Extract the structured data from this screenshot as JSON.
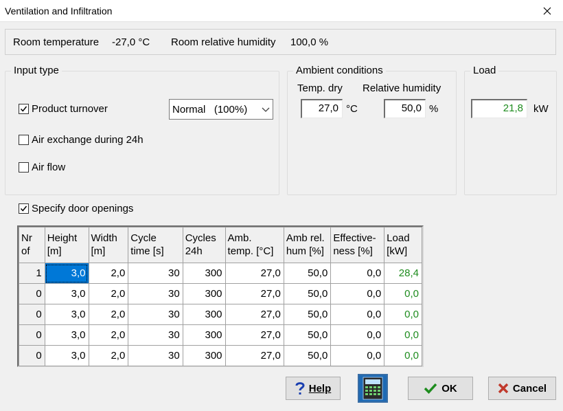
{
  "window": {
    "title": "Ventilation and Infiltration"
  },
  "status": {
    "room_temperature_label": "Room temperature",
    "room_temperature_value": "-27,0 °C",
    "room_humidity_label": "Room relative humidity",
    "room_humidity_value": "100,0 %"
  },
  "input_type": {
    "group_label": "Input type",
    "product_turnover": {
      "label": "Product turnover",
      "checked": true
    },
    "turnover_select": "Normal   (100%)",
    "air_exchange": {
      "label": "Air exchange during 24h",
      "checked": false
    },
    "air_flow": {
      "label": "Air flow",
      "checked": false
    }
  },
  "ambient": {
    "group_label": "Ambient conditions",
    "temp_dry_label": "Temp. dry",
    "rel_humidity_label": "Relative humidity",
    "temp_dry_value": "27,0",
    "temp_unit": "°C",
    "rel_humidity_value": "50,0",
    "humidity_unit": "%"
  },
  "load": {
    "group_label": "Load",
    "value": "21,8",
    "unit": "kW"
  },
  "door_openings": {
    "label": "Specify door openings",
    "checked": true,
    "columns": [
      [
        "Nr",
        "of"
      ],
      [
        "Height",
        "[m]"
      ],
      [
        "Width",
        "[m]"
      ],
      [
        "Cycle",
        "time [s]"
      ],
      [
        "Cycles",
        "24h"
      ],
      [
        "Amb.",
        "temp. [°C]"
      ],
      [
        "Amb rel.",
        "hum [%]"
      ],
      [
        "Effective-",
        "ness [%]"
      ],
      [
        "Load",
        "[kW]"
      ]
    ],
    "rows": [
      [
        "1",
        "3,0",
        "2,0",
        "30",
        "300",
        "27,0",
        "50,0",
        "0,0",
        "28,4"
      ],
      [
        "0",
        "3,0",
        "2,0",
        "30",
        "300",
        "27,0",
        "50,0",
        "0,0",
        "0,0"
      ],
      [
        "0",
        "3,0",
        "2,0",
        "30",
        "300",
        "27,0",
        "50,0",
        "0,0",
        "0,0"
      ],
      [
        "0",
        "3,0",
        "2,0",
        "30",
        "300",
        "27,0",
        "50,0",
        "0,0",
        "0,0"
      ],
      [
        "0",
        "3,0",
        "2,0",
        "30",
        "300",
        "27,0",
        "50,0",
        "0,0",
        "0,0"
      ]
    ]
  },
  "buttons": {
    "help": "Help",
    "ok": "OK",
    "cancel": "Cancel"
  },
  "colors": {
    "load_value": "#1e8c1e",
    "selection": "#0078d7",
    "cancel_x": "#c0392b",
    "ok_check": "#1e8c1e",
    "help_q": "#1a3fb0"
  }
}
